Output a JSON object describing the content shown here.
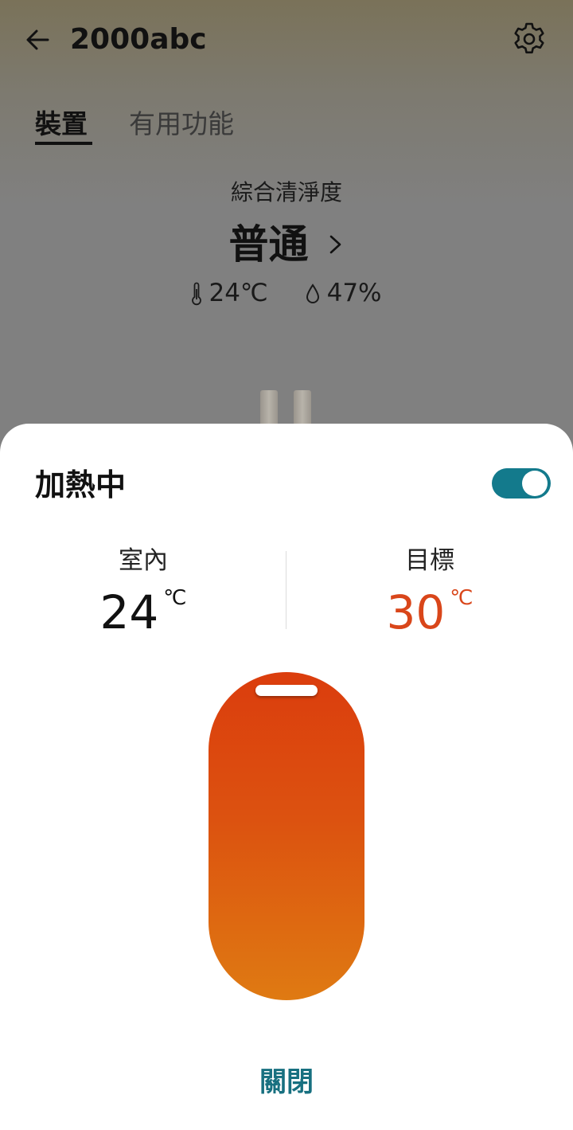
{
  "header": {
    "title": "2000abc",
    "back_icon": "arrow-left-icon",
    "settings_icon": "gear-icon"
  },
  "tabs": [
    {
      "label": "裝置",
      "active": true
    },
    {
      "label": "有用功能",
      "active": false
    }
  ],
  "summary": {
    "label": "綜合清淨度",
    "value": "普通",
    "temperature": "24℃",
    "humidity": "47%"
  },
  "sheet": {
    "title": "加熱中",
    "toggle_on": true,
    "indoor": {
      "label": "室內",
      "value": "24",
      "unit": "℃"
    },
    "target": {
      "label": "目標",
      "value": "30",
      "unit": "℃"
    },
    "slider_level": 1.0,
    "close_label": "關閉"
  },
  "colors": {
    "accent": "#137a8c",
    "target_temp": "#d9461a",
    "slider_top": "#db3d0d",
    "slider_bottom": "#df7a12"
  }
}
